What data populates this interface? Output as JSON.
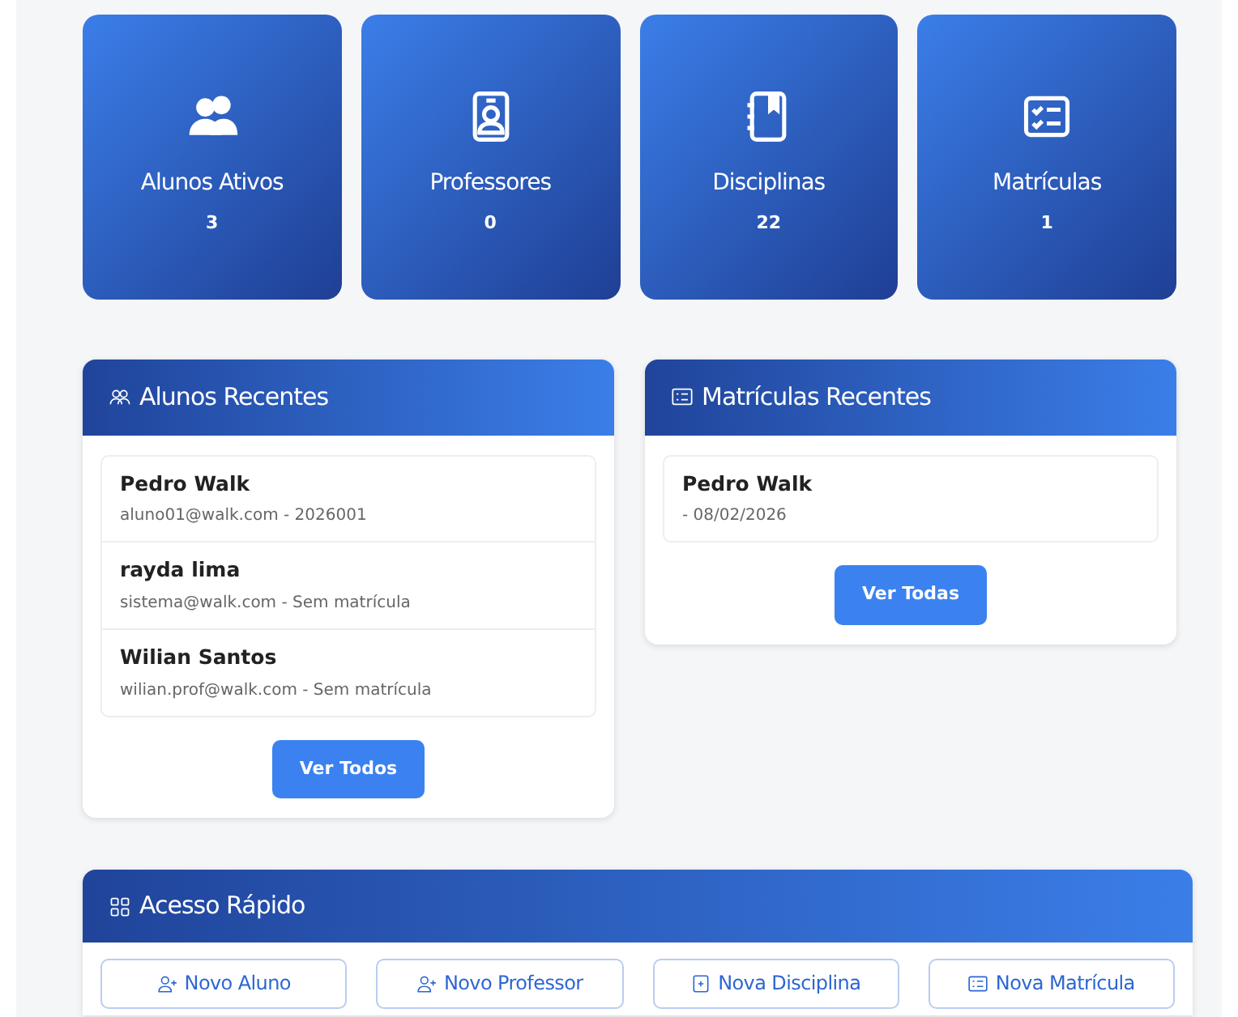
{
  "stats": [
    {
      "label": "Alunos Ativos",
      "value": "3"
    },
    {
      "label": "Professores",
      "value": "0"
    },
    {
      "label": "Disciplinas",
      "value": "22"
    },
    {
      "label": "Matrículas",
      "value": "1"
    }
  ],
  "recent_students": {
    "title": "Alunos Recentes",
    "items": [
      {
        "name": "Pedro Walk",
        "detail": "aluno01@walk.com - 2026001"
      },
      {
        "name": "rayda lima",
        "detail": "sistema@walk.com - Sem matrícula"
      },
      {
        "name": "Wilian Santos",
        "detail": "wilian.prof@walk.com - Sem matrícula"
      }
    ],
    "button": "Ver Todos"
  },
  "recent_enrollments": {
    "title": "Matrículas Recentes",
    "items": [
      {
        "name": "Pedro Walk",
        "detail": "- 08/02/2026"
      }
    ],
    "button": "Ver Todas"
  },
  "quick_access": {
    "title": "Acesso Rápido",
    "buttons": [
      "Novo Aluno",
      "Novo Professor",
      "Nova Disciplina",
      "Nova Matrícula"
    ]
  }
}
